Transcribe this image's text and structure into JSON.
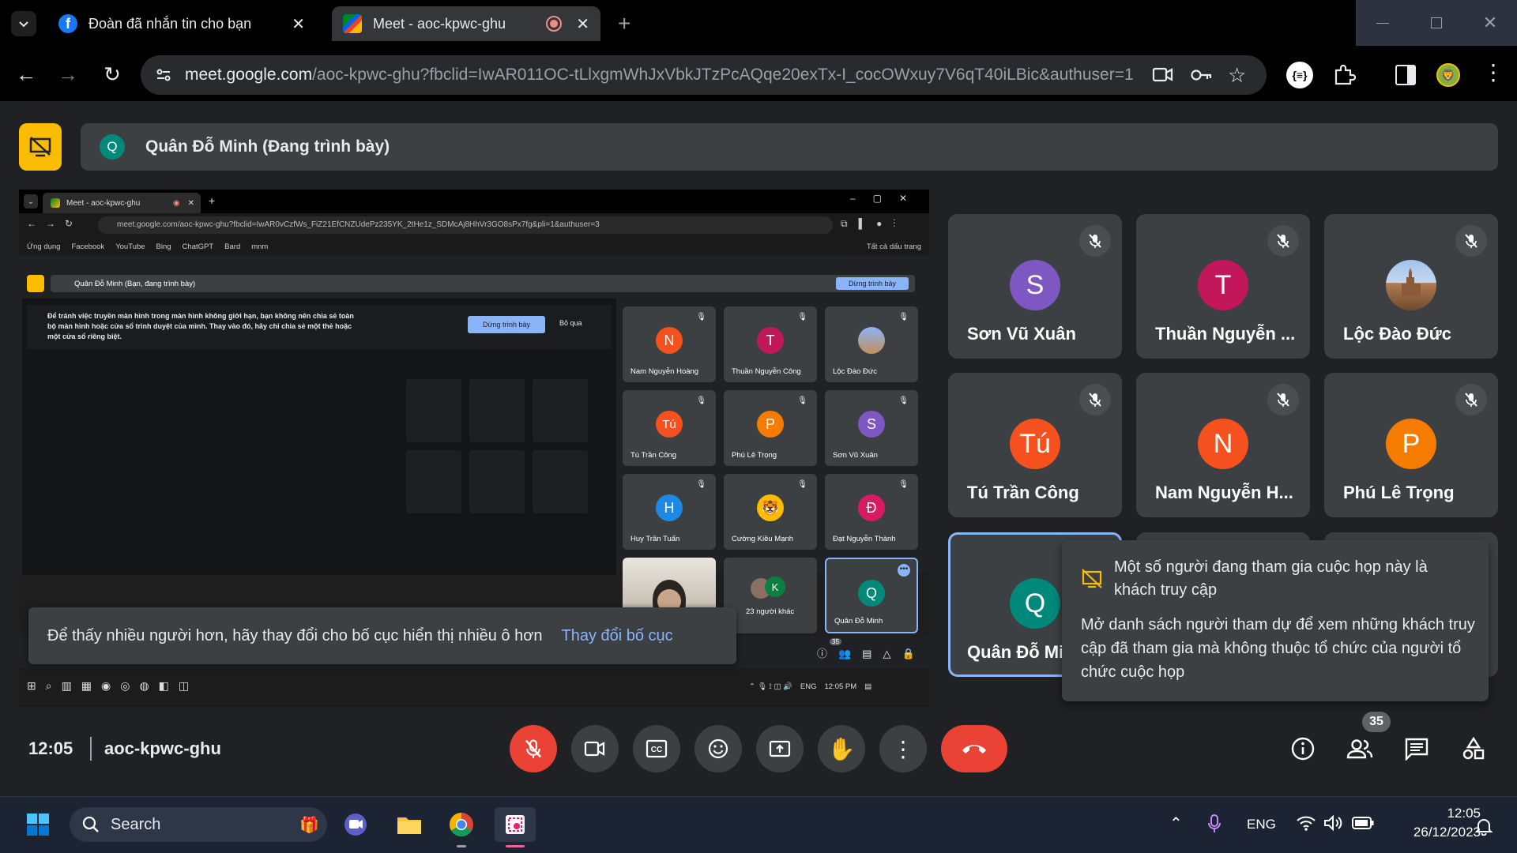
{
  "browser": {
    "tabs": [
      {
        "title": "Đoàn đã nhắn tin cho bạn"
      },
      {
        "title": "Meet - aoc-kpwc-ghu"
      }
    ],
    "url_host": "meet.google.com",
    "url_path": "/aoc-kpwc-ghu?fbclid=IwAR011OC-tLlxgmWhJxVbkJTzPcAQqe20exTx-I_cocOWxuy7V6qT40iLBic&authuser=1"
  },
  "meet": {
    "presenter_initial": "Q",
    "presenting_label": "Quân Đỗ Minh (Đang trình bày)",
    "time": "12:05",
    "meeting_code": "aoc-kpwc-ghu",
    "participant_count": "35",
    "tiles": [
      {
        "initial": "S",
        "name": "Sơn Vũ Xuân",
        "color": "#7e57c2"
      },
      {
        "initial": "T",
        "name": "Thuần Nguyễn ...",
        "color": "#c2185b"
      },
      {
        "initial": "",
        "name": "Lộc Đào Đức",
        "color": "#8ab4f8"
      },
      {
        "initial": "Tú",
        "name": "Tú Trần Công",
        "color": "#f4511e"
      },
      {
        "initial": "N",
        "name": "Nam Nguyễn H...",
        "color": "#f4511e"
      },
      {
        "initial": "P",
        "name": "Phú Lê Trọng",
        "color": "#f57c00"
      },
      {
        "initial": "Q",
        "name": "Quân Đỗ Mi",
        "color": "#00897b"
      }
    ],
    "layout_toast": {
      "text": "Để thấy nhiều người hơn, hãy thay đổi cho bố cục hiển thị nhiều ô hơn",
      "action": "Thay đổi bố cục"
    },
    "guest_notice": {
      "title": "Một số người đang tham gia cuộc họp này là khách truy cập",
      "body": "Mở danh sách người tham dự để xem những khách truy cập đã tham gia mà không thuộc tổ chức của người tổ chức cuộc họp"
    }
  },
  "shared_screen": {
    "tab_title": "Meet - aoc-kpwc-ghu",
    "url": "meet.google.com/aoc-kpwc-ghu?fbclid=IwAR0vCzfWs_FiZ21EfCNZUdePz235YK_2tHe1z_SDMcAj8HhVr3GO8sPx7fg&pli=1&authuser=3",
    "bookmarks": [
      "Ứng dụng",
      "Facebook",
      "YouTube",
      "Bing",
      "ChatGPT",
      "Bard",
      "mnm"
    ],
    "all_bookmarks": "Tất cả dấu trang",
    "presenting_label": "Quân Đỗ Minh (Bạn, đang trình bày)",
    "stop_button": "Dừng trình bày",
    "warning_text": "Để tránh việc truyền màn hình trong màn hình không giới hạn, bạn không nên chia sẻ toàn bộ màn hình hoặc cửa sổ trình duyệt của mình. Thay vào đó, hãy chỉ chia sẻ một thẻ hoặc một cửa sổ riêng biệt.",
    "warning_stop": "Dừng trình bày",
    "warning_skip": "Bỏ qua",
    "tiles": [
      {
        "initial": "N",
        "name": "Nam Nguyễn Hoàng",
        "color": "#f4511e"
      },
      {
        "initial": "T",
        "name": "Thuần Nguyễn Công",
        "color": "#c2185b"
      },
      {
        "initial": "",
        "name": "Lộc Đào Đức",
        "color": "#8ab4f8"
      },
      {
        "initial": "Tú",
        "name": "Tú Trần Công",
        "color": "#f4511e"
      },
      {
        "initial": "P",
        "name": "Phú Lê Trọng",
        "color": "#f57c00"
      },
      {
        "initial": "S",
        "name": "Sơn Vũ Xuân",
        "color": "#7e57c2"
      },
      {
        "initial": "H",
        "name": "Huy Trần Tuấn",
        "color": "#1e88e5"
      },
      {
        "initial": "",
        "name": "Cường Kiều Mạnh",
        "color": "#fbbc04"
      },
      {
        "initial": "Đ",
        "name": "Đạt Nguyễn Thành",
        "color": "#d81b60"
      },
      {
        "initial": "",
        "name": "",
        "color": "#5f6368"
      },
      {
        "initial": "K",
        "name": "23 người khác",
        "color": "#0b8043"
      },
      {
        "initial": "Q",
        "name": "Quân Đỗ Minh",
        "color": "#00897b"
      }
    ],
    "count": "35",
    "lang": "ENG",
    "time": "12:05 PM"
  },
  "taskbar": {
    "search_placeholder": "Search",
    "lang": "ENG",
    "time": "12:05",
    "date": "26/12/2023"
  }
}
